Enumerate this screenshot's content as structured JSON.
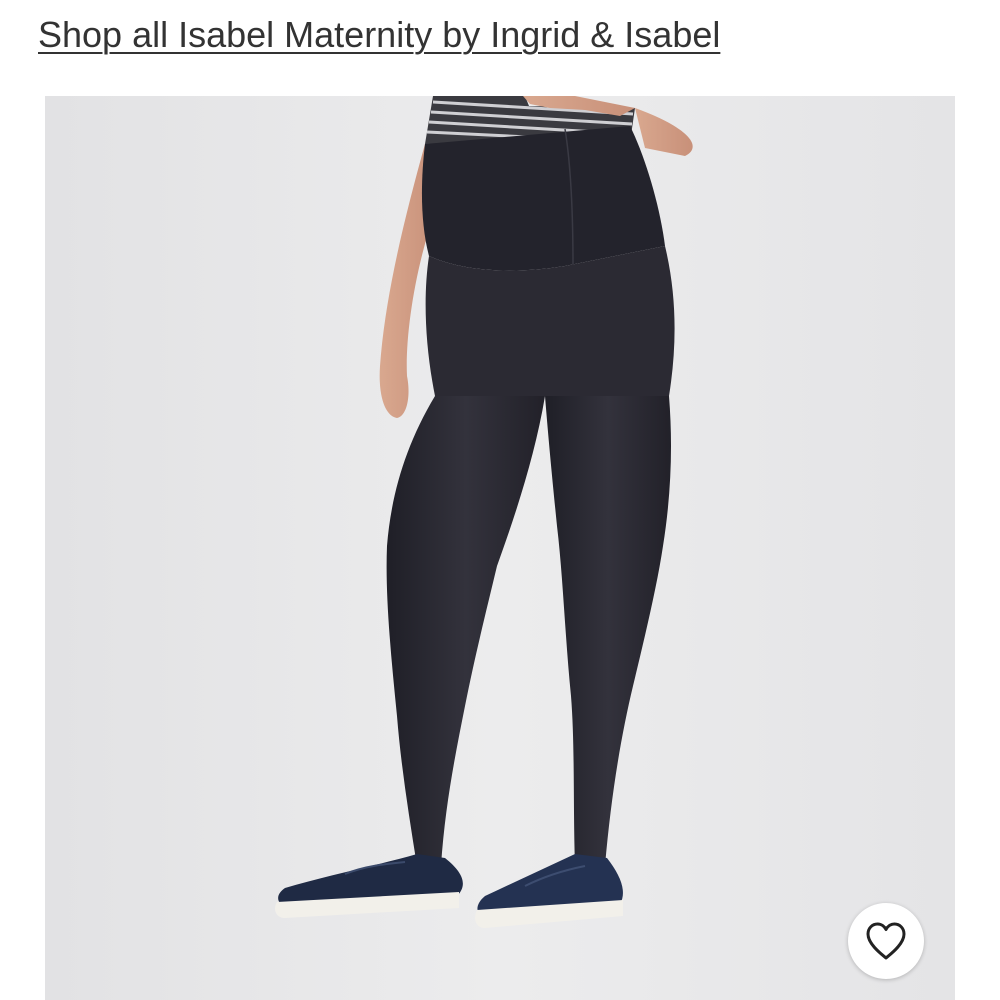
{
  "header": {
    "shop_link": "Shop all Isabel Maternity by Ingrid & Isabel"
  },
  "product": {
    "image_description_icon": "maternity-leggings-photo",
    "favorite_icon": "heart-icon"
  },
  "colors": {
    "background": "#e5e5e6",
    "link_text": "#333333",
    "leggings": "#2a2a33",
    "shoes": "#1f2a44"
  }
}
